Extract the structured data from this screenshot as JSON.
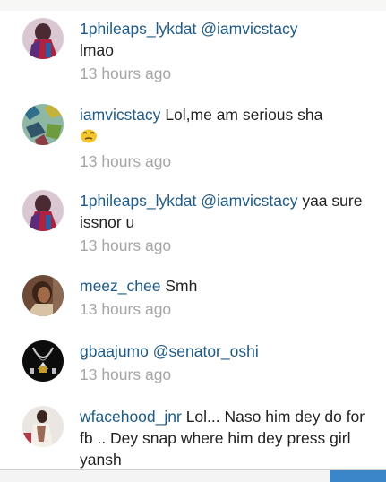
{
  "comments": [
    {
      "username": "1phileaps_lykdat",
      "mention": "@iamvicstacy",
      "text": "lmao",
      "time": "13 hours ago",
      "avatar": "avatar-red-purple"
    },
    {
      "username": "iamvicstacy",
      "mention": "",
      "text": "Lol,me am serious sha",
      "emoji": "unamused-face-icon",
      "time": "13 hours ago",
      "avatar": "avatar-green-pattern"
    },
    {
      "username": "1phileaps_lykdat",
      "mention": "@iamvicstacy",
      "text": " yaa sure issnor u",
      "time": "13 hours ago",
      "avatar": "avatar-red-purple"
    },
    {
      "username": "meez_chee",
      "mention": "",
      "text": "Smh",
      "time": "13 hours ago",
      "avatar": "avatar-portrait-dark"
    },
    {
      "username": "gbaajumo",
      "mention": "@senator_oshi",
      "text": "",
      "time": "13 hours ago",
      "avatar": "avatar-necklace-black"
    },
    {
      "username": "wfacehood_jnr",
      "mention": "",
      "text": "Lol... Naso him dey do for fb .. Dey snap where him dey press girl yansh",
      "time": "",
      "avatar": "avatar-photo-light"
    }
  ]
}
